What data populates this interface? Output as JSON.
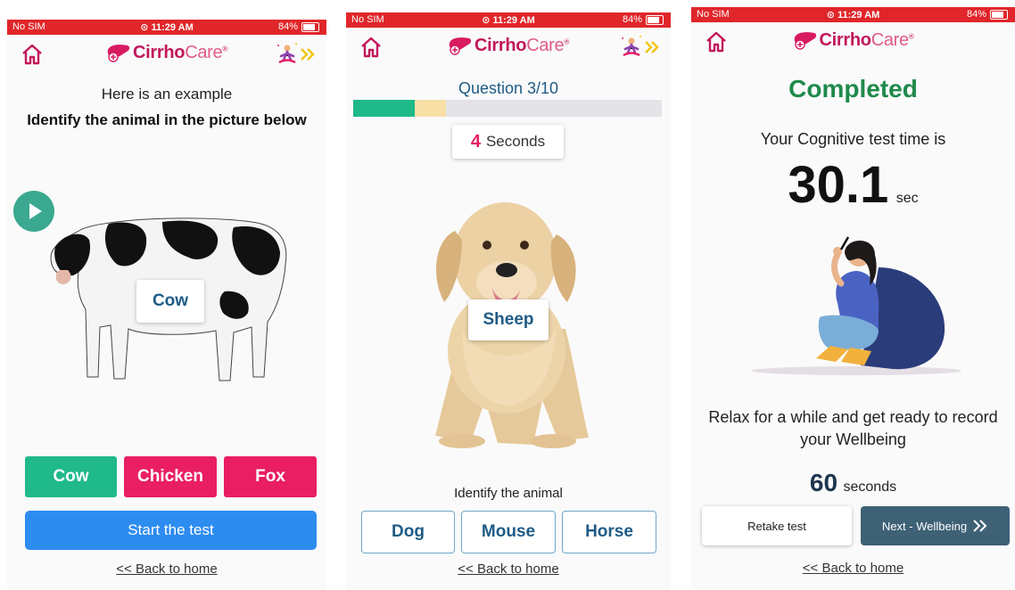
{
  "colors": {
    "status_bar": "#e0262a",
    "brand": "#c2185b",
    "green": "#1fb98a",
    "pink": "#e91e63",
    "blue": "#2d8cf0",
    "completed": "#1e8a4a"
  },
  "status": {
    "carrier": "No SIM",
    "time": "⊙ 11:29 AM",
    "battery": "84%"
  },
  "brand": {
    "name_bold": "Cirrho",
    "name_light": "Care",
    "reg": "®"
  },
  "screen1": {
    "intro": "Here is an example",
    "instruction": "Identify the animal in the picture below",
    "image_label": "Cow",
    "options": [
      "Cow",
      "Chicken",
      "Fox"
    ],
    "start_button": "Start the test",
    "back_link": "<< Back to home"
  },
  "screen2": {
    "question": "Question 3/10",
    "progress": {
      "completed": 2,
      "current": 3,
      "total": 10
    },
    "timer_value": "4",
    "timer_unit": "Seconds",
    "image_label": "Sheep",
    "prompt": "Identify the animal",
    "options": [
      "Dog",
      "Mouse",
      "Horse"
    ],
    "back_link": "<< Back to home"
  },
  "screen3": {
    "title": "Completed",
    "subtitle": "Your Cognitive test time is",
    "time_value": "30.1",
    "time_unit": "sec",
    "message": "Relax for a while and get ready to record your Wellbeing",
    "countdown_value": "60",
    "countdown_unit": "seconds",
    "retake_button": "Retake test",
    "next_button": "Next - Wellbeing",
    "back_link": "<< Back to home"
  }
}
